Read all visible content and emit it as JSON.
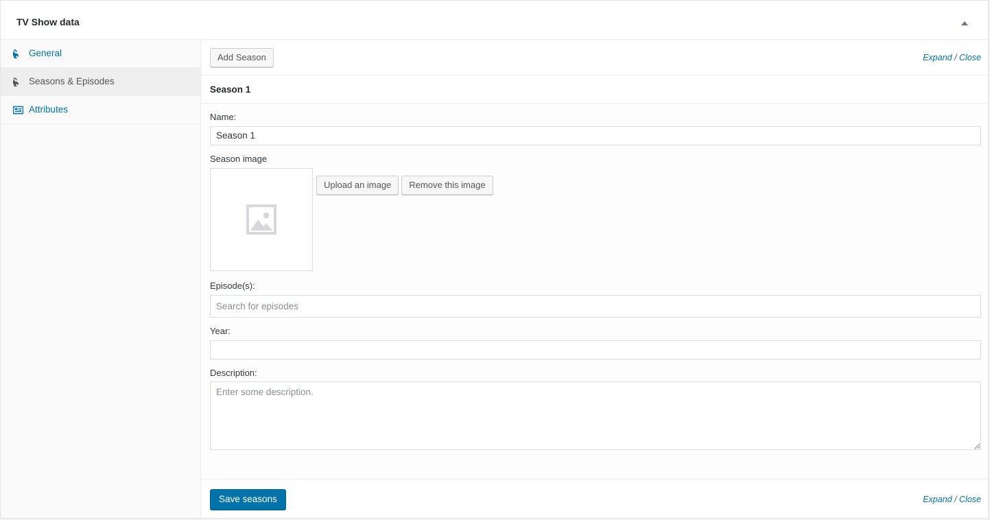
{
  "metabox": {
    "title": "TV Show data",
    "collapse_toggle_icon": "caret-up-icon"
  },
  "sidebar": {
    "items": [
      {
        "label": "General",
        "icon": "wrench-icon",
        "active": false
      },
      {
        "label": "Seasons & Episodes",
        "icon": "wrench-icon",
        "active": true
      },
      {
        "label": "Attributes",
        "icon": "table-list-icon",
        "active": false
      }
    ]
  },
  "toolbar": {
    "add_season_label": "Add Season",
    "expand_label": "Expand",
    "separator": "/",
    "close_label": "Close"
  },
  "season": {
    "header": "Season 1",
    "name": {
      "label": "Name:",
      "value": "Season 1"
    },
    "image": {
      "label": "Season image",
      "placeholder_icon": "image-placeholder-icon",
      "upload_label": "Upload an image",
      "remove_label": "Remove this image"
    },
    "episodes": {
      "label": "Episode(s):",
      "value": "",
      "placeholder": "Search for episodes"
    },
    "year": {
      "label": "Year:",
      "value": "",
      "placeholder": ""
    },
    "description": {
      "label": "Description:",
      "value": "",
      "placeholder": "Enter some description."
    }
  },
  "footer": {
    "save_label": "Save seasons",
    "expand_label": "Expand",
    "separator": "/",
    "close_label": "Close"
  },
  "colors": {
    "link": "#0073aa",
    "primary_button": "#0073aa",
    "border": "#eeeeee",
    "active_tab_bg": "#eeeeee"
  }
}
